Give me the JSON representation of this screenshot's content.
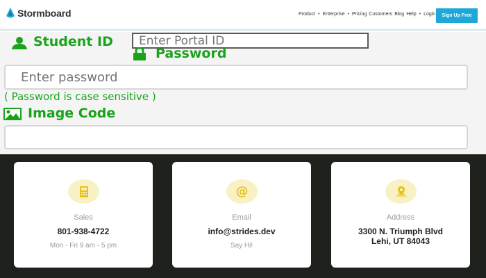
{
  "header": {
    "logo_text": "Stormboard",
    "nav": {
      "product": "Product",
      "enterprise": "Enterprise",
      "pricing": "Pricing",
      "customers": "Customers",
      "blog": "Blog",
      "help": "Help",
      "login": "Login →"
    },
    "signup_label": "Sign Up Free"
  },
  "form": {
    "student_label": "Student ID",
    "portal_placeholder": "Enter Portal ID",
    "password_label": "Password",
    "password_placeholder": "Enter password",
    "hint": "( Password is case sensitive )",
    "image_code_label": "Image Code",
    "image_code_value": "",
    "accent_color": "#1aa31a"
  },
  "contact": {
    "cards": [
      {
        "icon": "calculator-icon",
        "title": "Sales",
        "value": "801-938-4722",
        "sub": "Mon - Fri 9 am - 5 pm"
      },
      {
        "icon": "at-sign-icon",
        "title": "Email",
        "value": "info@strides.dev",
        "sub": "Say Hi!"
      },
      {
        "icon": "map-pin-icon",
        "title": "Address",
        "line1": "3300 N. Triumph Blvd",
        "line2": "Lehi, UT 84043"
      }
    ],
    "background": "#1f211c",
    "icon_bg": "#f7f1c4",
    "icon_color": "#e6c21a"
  }
}
